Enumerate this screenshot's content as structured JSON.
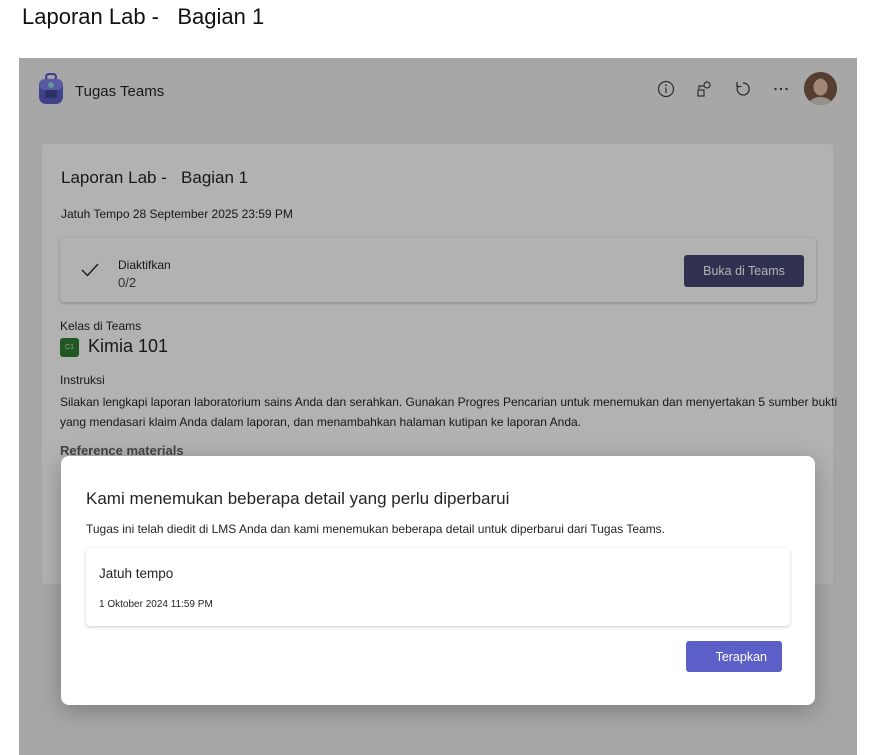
{
  "page": {
    "title": "Laporan Lab -   Bagian 1"
  },
  "app": {
    "name": "Tugas Teams",
    "icons": [
      "info-icon",
      "share-icon",
      "refresh-icon",
      "more-icon"
    ],
    "accent": "#464775"
  },
  "assignment": {
    "title": "Laporan Lab -   Bagian 1",
    "due": "Jatuh Tempo 28 September 2025 23:59 PM",
    "status": {
      "label": "Diaktifkan",
      "count": "0/2"
    },
    "open_button": "Buka di Teams",
    "class_label": "Kelas di Teams",
    "class_badge": "C1",
    "class_name": "Kimia 101",
    "instructions_label": "Instruksi",
    "instructions_text": "Silakan lengkapi laporan laboratorium sains Anda dan serahkan. Gunakan Progres Pencarian untuk menemukan dan menyertakan 5 sumber bukti yang mendasari klaim Anda dalam laporan, dan menambahkan halaman kutipan ke laporan Anda.",
    "reference_label": "Reference materials"
  },
  "dialog": {
    "title": "Kami menemukan beberapa detail yang perlu diperbarui",
    "description": "Tugas ini telah diedit di LMS Anda dan kami menemukan beberapa detail untuk diperbarui dari Tugas Teams.",
    "detail_label": "Jatuh tempo",
    "detail_value": "1 Oktober 2024 11:59 PM",
    "apply_button": "Terapkan",
    "apply_color": "#5b5fc7"
  }
}
